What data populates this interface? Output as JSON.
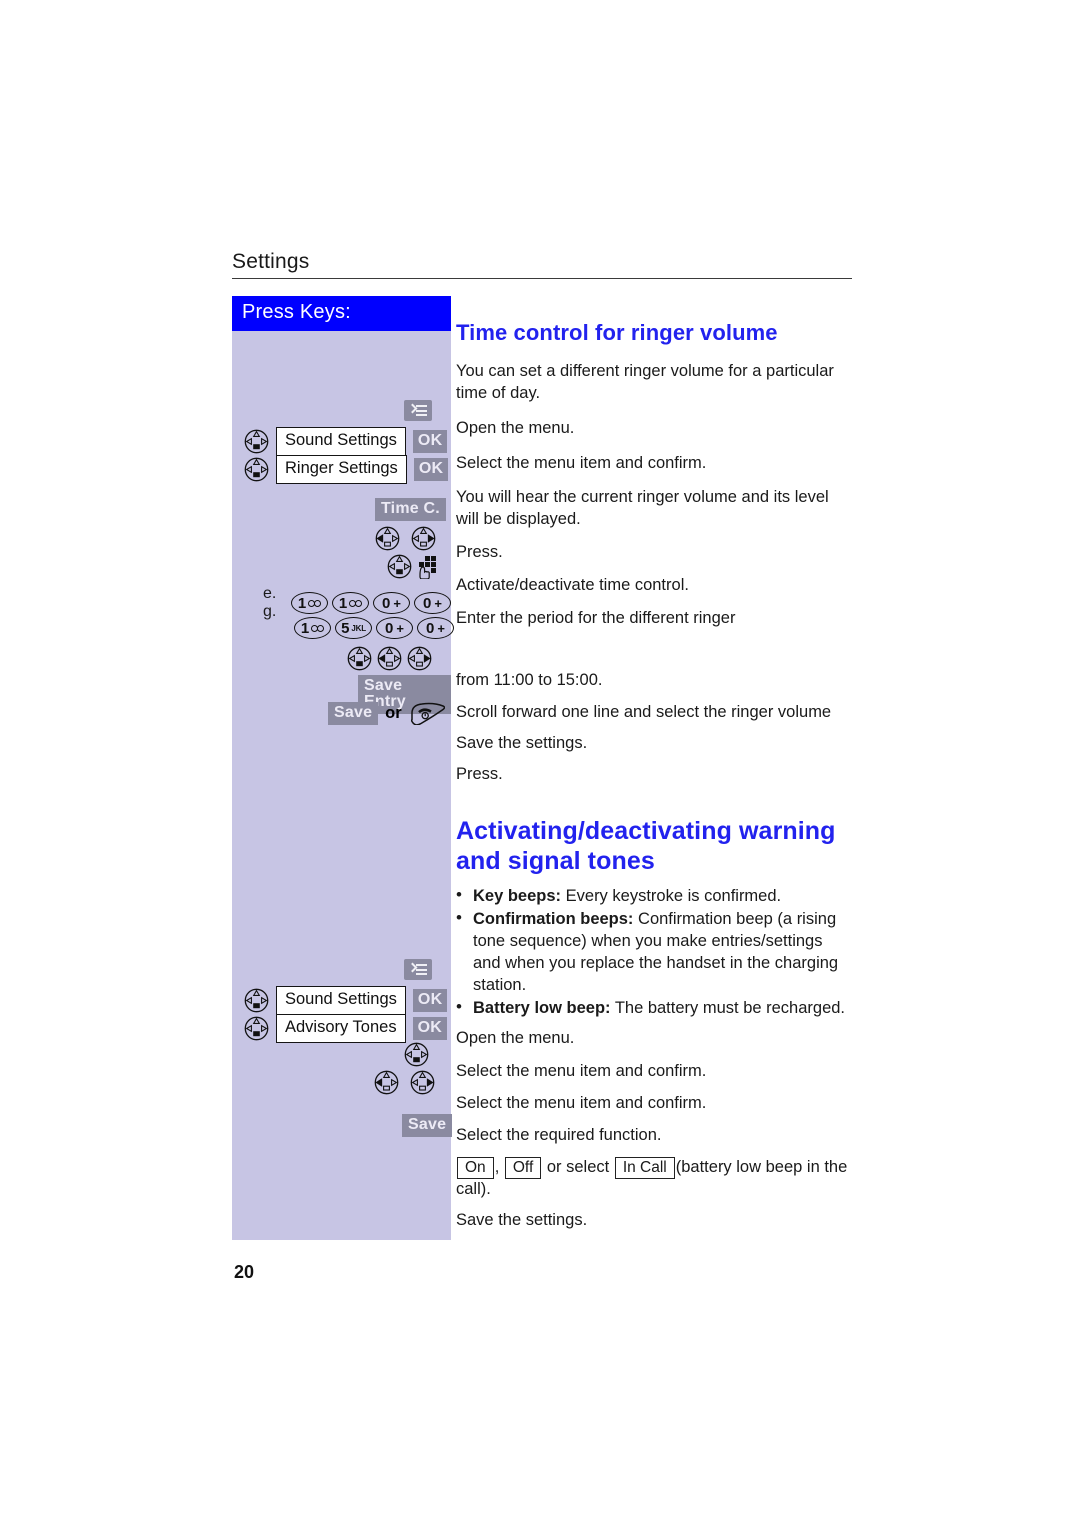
{
  "meta": {
    "running_head": "Settings",
    "page_number": "20"
  },
  "colors": {
    "heading_blue": "#2222ee",
    "panel_header_blue": "#0000ff",
    "sidebar_lavender": "#c7c5e4",
    "softkey_grey": "#8a8aa0"
  },
  "left_panel": {
    "header": "Press Keys:",
    "keys": {
      "menu_icon": "menu-icon",
      "nav_key_icon": "navigation-key-icon",
      "keypad_icon": "keypad-icon",
      "hangup_icon": "hangup-key-icon",
      "ok_label": "OK",
      "sound_settings": "Sound Settings",
      "ringer_settings": "Ringer Settings",
      "advisory_tones": "Advisory Tones",
      "time_c": "Time C.",
      "save_entry": "Save Entry",
      "save": "Save",
      "or": "or",
      "eg": "e. g.",
      "num_1": "1",
      "num_5": "5",
      "num_5_letters": "JKL",
      "num_0": "0",
      "num_0_plus": "+"
    }
  },
  "section_1": {
    "title": "Time control for ringer volume",
    "intro": "You can set a different ringer volume for a particular time of day.",
    "steps": [
      "Open the menu.",
      "Select the menu item and confirm.",
      "You will hear the current ringer volume and its level will be displayed.",
      "Press.",
      "Activate/deactivate time control.",
      "Enter the period for the different ringer",
      "from 11:00 to 15:00.",
      "Scroll forward one line and select the ringer volume",
      "Save the settings.",
      "Press."
    ]
  },
  "section_2": {
    "title": "Activating/deactivating warning and signal tones",
    "bullets": [
      {
        "term": "Key beeps:",
        "text": " Every keystroke is confirmed."
      },
      {
        "term": "Confirmation beeps:",
        "text": " Confirmation beep (a rising tone sequence) when you make entries/settings and when you replace the handset in the charging station."
      },
      {
        "term": "Battery low beep:",
        "text": " The battery must be recharged."
      }
    ],
    "steps": [
      "Open the menu.",
      "Select the menu item and confirm.",
      "Select the menu item and confirm.",
      "Select the required function.",
      "Save the settings."
    ],
    "option_line": {
      "on": "On",
      "comma": ",",
      "off": "Off",
      "middle": "or select",
      "in_call": "In Call",
      "tail": "(battery low beep in the call)."
    }
  }
}
